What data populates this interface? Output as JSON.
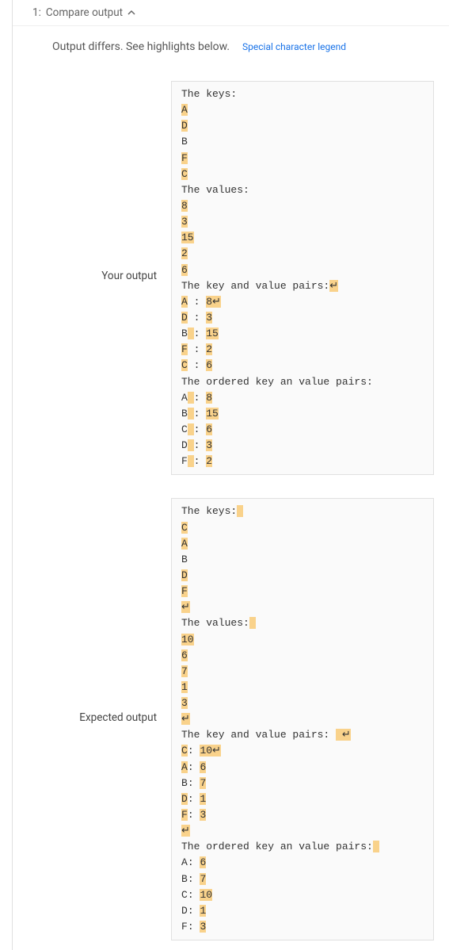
{
  "header": {
    "index": "1:",
    "title": "Compare output"
  },
  "subheader": {
    "text": "Output differs. See highlights below.",
    "legend_link": "Special character legend"
  },
  "your_output_label": "Your output",
  "expected_output_label": "Expected output",
  "chart_data": null,
  "your_output": {
    "lines": [
      {
        "segments": [
          {
            "t": "The keys:",
            "h": false
          }
        ]
      },
      {
        "segments": [
          {
            "t": "A",
            "h": true
          }
        ]
      },
      {
        "segments": [
          {
            "t": "D",
            "h": true
          }
        ]
      },
      {
        "segments": [
          {
            "t": "B",
            "h": false
          }
        ]
      },
      {
        "segments": [
          {
            "t": "F",
            "h": true
          }
        ]
      },
      {
        "segments": [
          {
            "t": "C",
            "h": true
          }
        ]
      },
      {
        "segments": [
          {
            "t": "The values:",
            "h": false
          }
        ]
      },
      {
        "segments": [
          {
            "t": "8",
            "h": true
          }
        ]
      },
      {
        "segments": [
          {
            "t": "3",
            "h": true
          }
        ]
      },
      {
        "segments": [
          {
            "t": "15",
            "h": true
          }
        ]
      },
      {
        "segments": [
          {
            "t": "2",
            "h": true
          }
        ]
      },
      {
        "segments": [
          {
            "t": "6",
            "h": true
          }
        ]
      },
      {
        "segments": [
          {
            "t": "The key and value pairs:",
            "h": false
          },
          {
            "t": "↵",
            "h": true
          }
        ]
      },
      {
        "segments": [
          {
            "t": "A",
            "h": true
          },
          {
            "t": " ",
            "h": false
          },
          {
            "t": ":",
            "h": false
          },
          {
            "t": " ",
            "h": false
          },
          {
            "t": "8↵",
            "h": true
          }
        ]
      },
      {
        "segments": [
          {
            "t": "D",
            "h": true
          },
          {
            "t": " ",
            "h": false
          },
          {
            "t": ":",
            "h": false
          },
          {
            "t": " ",
            "h": false
          },
          {
            "t": "3",
            "h": true
          }
        ]
      },
      {
        "segments": [
          {
            "t": "B",
            "h": false
          },
          {
            "t": " ",
            "h": true
          },
          {
            "t": ":",
            "h": false
          },
          {
            "t": " ",
            "h": false
          },
          {
            "t": "15",
            "h": true
          }
        ]
      },
      {
        "segments": [
          {
            "t": "F",
            "h": true
          },
          {
            "t": " ",
            "h": false
          },
          {
            "t": ":",
            "h": false
          },
          {
            "t": " ",
            "h": false
          },
          {
            "t": "2",
            "h": true
          }
        ]
      },
      {
        "segments": [
          {
            "t": "C",
            "h": true
          },
          {
            "t": " ",
            "h": false
          },
          {
            "t": ":",
            "h": false
          },
          {
            "t": " ",
            "h": false
          },
          {
            "t": "6",
            "h": true
          }
        ]
      },
      {
        "segments": [
          {
            "t": "The ordered key an value pairs:",
            "h": false
          }
        ]
      },
      {
        "segments": [
          {
            "t": "A",
            "h": false
          },
          {
            "t": " ",
            "h": true
          },
          {
            "t": ":",
            "h": false
          },
          {
            "t": " ",
            "h": false
          },
          {
            "t": "8",
            "h": true
          }
        ]
      },
      {
        "segments": [
          {
            "t": "B",
            "h": false
          },
          {
            "t": " ",
            "h": true
          },
          {
            "t": ":",
            "h": false
          },
          {
            "t": " ",
            "h": false
          },
          {
            "t": "15",
            "h": true
          }
        ]
      },
      {
        "segments": [
          {
            "t": "C",
            "h": false
          },
          {
            "t": " ",
            "h": true
          },
          {
            "t": ":",
            "h": false
          },
          {
            "t": " ",
            "h": false
          },
          {
            "t": "6",
            "h": true
          }
        ]
      },
      {
        "segments": [
          {
            "t": "D",
            "h": false
          },
          {
            "t": " ",
            "h": true
          },
          {
            "t": ":",
            "h": false
          },
          {
            "t": " ",
            "h": false
          },
          {
            "t": "3",
            "h": true
          }
        ]
      },
      {
        "segments": [
          {
            "t": "F",
            "h": false
          },
          {
            "t": " ",
            "h": true
          },
          {
            "t": ":",
            "h": false
          },
          {
            "t": " ",
            "h": false
          },
          {
            "t": "2",
            "h": true
          }
        ]
      }
    ]
  },
  "expected_output": {
    "lines": [
      {
        "segments": [
          {
            "t": "The keys:",
            "h": false
          },
          {
            "t": " ",
            "h": true
          }
        ]
      },
      {
        "segments": [
          {
            "t": "C",
            "h": true
          }
        ]
      },
      {
        "segments": [
          {
            "t": "A",
            "h": true
          }
        ]
      },
      {
        "segments": [
          {
            "t": "B",
            "h": false
          }
        ]
      },
      {
        "segments": [
          {
            "t": "D",
            "h": true
          }
        ]
      },
      {
        "segments": [
          {
            "t": "F",
            "h": true
          }
        ]
      },
      {
        "segments": [
          {
            "t": "↵",
            "h": true
          }
        ]
      },
      {
        "segments": [
          {
            "t": "The values:",
            "h": false
          },
          {
            "t": " ",
            "h": true
          }
        ]
      },
      {
        "segments": [
          {
            "t": "10",
            "h": true
          }
        ]
      },
      {
        "segments": [
          {
            "t": "6",
            "h": true
          }
        ]
      },
      {
        "segments": [
          {
            "t": "7",
            "h": true
          }
        ]
      },
      {
        "segments": [
          {
            "t": "1",
            "h": true
          }
        ]
      },
      {
        "segments": [
          {
            "t": "3",
            "h": true
          }
        ]
      },
      {
        "segments": [
          {
            "t": "↵",
            "h": true
          }
        ]
      },
      {
        "segments": [
          {
            "t": "The key and value pairs:",
            "h": false
          },
          {
            "t": " ",
            "h": false
          },
          {
            "t": " ↵",
            "h": true
          }
        ]
      },
      {
        "segments": [
          {
            "t": "C",
            "h": true
          },
          {
            "t": ":",
            "h": false
          },
          {
            "t": " ",
            "h": false
          },
          {
            "t": "10↵",
            "h": true
          }
        ]
      },
      {
        "segments": [
          {
            "t": "A",
            "h": true
          },
          {
            "t": ":",
            "h": false
          },
          {
            "t": " ",
            "h": false
          },
          {
            "t": "6",
            "h": true
          }
        ]
      },
      {
        "segments": [
          {
            "t": "B",
            "h": false
          },
          {
            "t": ":",
            "h": false
          },
          {
            "t": " ",
            "h": false
          },
          {
            "t": "7",
            "h": true
          }
        ]
      },
      {
        "segments": [
          {
            "t": "D",
            "h": true
          },
          {
            "t": ":",
            "h": false
          },
          {
            "t": " ",
            "h": false
          },
          {
            "t": "1",
            "h": true
          }
        ]
      },
      {
        "segments": [
          {
            "t": "F",
            "h": true
          },
          {
            "t": ":",
            "h": false
          },
          {
            "t": " ",
            "h": false
          },
          {
            "t": "3",
            "h": true
          }
        ]
      },
      {
        "segments": [
          {
            "t": "↵",
            "h": true
          }
        ]
      },
      {
        "segments": [
          {
            "t": "The ordered key an value pairs:",
            "h": false
          },
          {
            "t": " ",
            "h": true
          }
        ]
      },
      {
        "segments": [
          {
            "t": "A",
            "h": false
          },
          {
            "t": ":",
            "h": false
          },
          {
            "t": " ",
            "h": false
          },
          {
            "t": "6",
            "h": true
          }
        ]
      },
      {
        "segments": [
          {
            "t": "B",
            "h": false
          },
          {
            "t": ":",
            "h": false
          },
          {
            "t": " ",
            "h": false
          },
          {
            "t": "7",
            "h": true
          }
        ]
      },
      {
        "segments": [
          {
            "t": "C",
            "h": false
          },
          {
            "t": ":",
            "h": false
          },
          {
            "t": " ",
            "h": false
          },
          {
            "t": "10",
            "h": true
          }
        ]
      },
      {
        "segments": [
          {
            "t": "D",
            "h": false
          },
          {
            "t": ":",
            "h": false
          },
          {
            "t": " ",
            "h": false
          },
          {
            "t": "1",
            "h": true
          }
        ]
      },
      {
        "segments": [
          {
            "t": "F",
            "h": false
          },
          {
            "t": ":",
            "h": false
          },
          {
            "t": " ",
            "h": false
          },
          {
            "t": "3",
            "h": true
          }
        ]
      }
    ]
  }
}
